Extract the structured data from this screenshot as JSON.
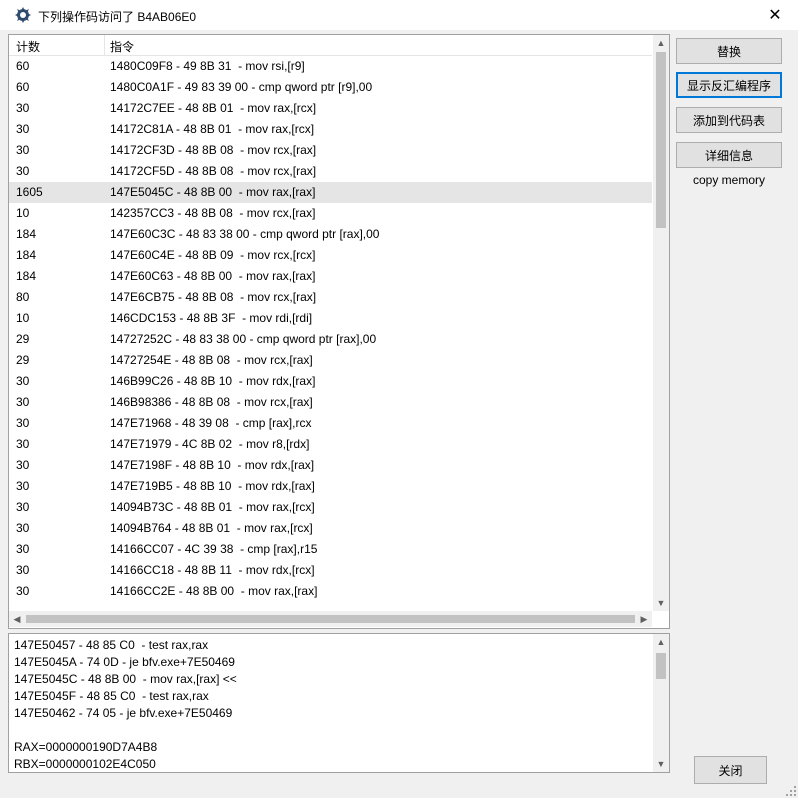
{
  "window": {
    "title": "下列操作码访问了 B4AB06E0",
    "close_glyph": "✕"
  },
  "table": {
    "columns": [
      "计数",
      "指令"
    ],
    "rows": [
      {
        "count": "60",
        "instr": "1480C09F8 - 49 8B 31  - mov rsi,[r9]"
      },
      {
        "count": "60",
        "instr": "1480C0A1F - 49 83 39 00 - cmp qword ptr [r9],00"
      },
      {
        "count": "30",
        "instr": "14172C7EE - 48 8B 01  - mov rax,[rcx]"
      },
      {
        "count": "30",
        "instr": "14172C81A - 48 8B 01  - mov rax,[rcx]"
      },
      {
        "count": "30",
        "instr": "14172CF3D - 48 8B 08  - mov rcx,[rax]"
      },
      {
        "count": "30",
        "instr": "14172CF5D - 48 8B 08  - mov rcx,[rax]"
      },
      {
        "count": "1605",
        "instr": "147E5045C - 48 8B 00  - mov rax,[rax]",
        "selected": true
      },
      {
        "count": "10",
        "instr": "142357CC3 - 48 8B 08  - mov rcx,[rax]"
      },
      {
        "count": "184",
        "instr": "147E60C3C - 48 83 38 00 - cmp qword ptr [rax],00"
      },
      {
        "count": "184",
        "instr": "147E60C4E - 48 8B 09  - mov rcx,[rcx]"
      },
      {
        "count": "184",
        "instr": "147E60C63 - 48 8B 00  - mov rax,[rax]"
      },
      {
        "count": "80",
        "instr": "147E6CB75 - 48 8B 08  - mov rcx,[rax]"
      },
      {
        "count": "10",
        "instr": "146CDC153 - 48 8B 3F  - mov rdi,[rdi]"
      },
      {
        "count": "29",
        "instr": "14727252C - 48 83 38 00 - cmp qword ptr [rax],00"
      },
      {
        "count": "29",
        "instr": "14727254E - 48 8B 08  - mov rcx,[rax]"
      },
      {
        "count": "30",
        "instr": "146B99C26 - 48 8B 10  - mov rdx,[rax]"
      },
      {
        "count": "30",
        "instr": "146B98386 - 48 8B 08  - mov rcx,[rax]"
      },
      {
        "count": "30",
        "instr": "147E71968 - 48 39 08  - cmp [rax],rcx"
      },
      {
        "count": "30",
        "instr": "147E71979 - 4C 8B 02  - mov r8,[rdx]"
      },
      {
        "count": "30",
        "instr": "147E7198F - 48 8B 10  - mov rdx,[rax]"
      },
      {
        "count": "30",
        "instr": "147E719B5 - 48 8B 10  - mov rdx,[rax]"
      },
      {
        "count": "30",
        "instr": "14094B73C - 48 8B 01  - mov rax,[rcx]"
      },
      {
        "count": "30",
        "instr": "14094B764 - 48 8B 01  - mov rax,[rcx]"
      },
      {
        "count": "30",
        "instr": "14166CC07 - 4C 39 38  - cmp [rax],r15"
      },
      {
        "count": "30",
        "instr": "14166CC18 - 48 8B 11  - mov rdx,[rcx]"
      },
      {
        "count": "30",
        "instr": "14166CC2E - 48 8B 00  - mov rax,[rax]"
      }
    ]
  },
  "disasm": {
    "lines": [
      "147E50457 - 48 85 C0  - test rax,rax",
      "147E5045A - 74 0D - je bfv.exe+7E50469",
      "147E5045C - 48 8B 00  - mov rax,[rax] <<",
      "147E5045F - 48 85 C0  - test rax,rax",
      "147E50462 - 74 05 - je bfv.exe+7E50469",
      "",
      "RAX=0000000190D7A4B8",
      "RBX=0000000102E4C050"
    ]
  },
  "buttons": {
    "replace": "替换",
    "show_disassembler": "显示反汇编程序",
    "add_to_codelist": "添加到代码表",
    "more_info": "详细信息",
    "copy_memory": "copy memory",
    "close": "关闭"
  },
  "scroll": {
    "list_vertical_position": 0.0,
    "disasm_vertical_position": 0.0
  },
  "icons": {
    "app": "cheat-engine-icon",
    "close": "close-icon",
    "up": "arrow-up-icon",
    "down": "arrow-down-icon",
    "left": "arrow-left-icon",
    "right": "arrow-right-icon"
  },
  "colors": {
    "selected_row": "#e5e5e5",
    "focus_border": "#0078d7",
    "button_bg": "#e1e1e1"
  }
}
